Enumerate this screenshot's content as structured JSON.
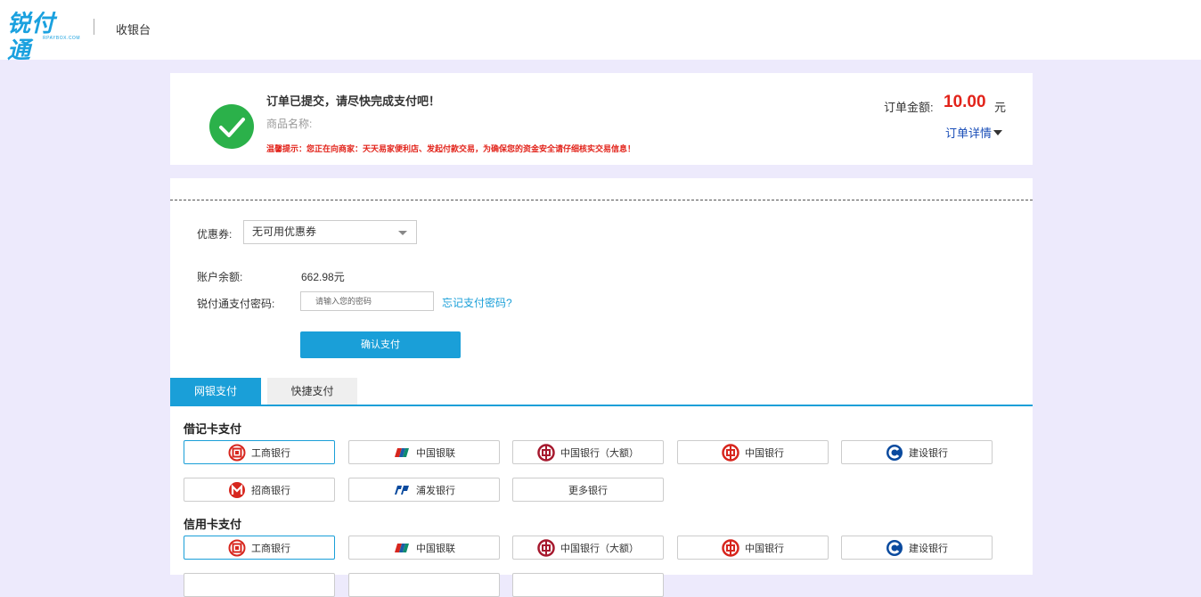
{
  "header": {
    "logo_text": "锐付通",
    "logo_sub": "RPAYBOX.COM",
    "title": "收银台"
  },
  "order": {
    "message": "订单已提交，请尽快完成支付吧！",
    "product_label": "商品名称:",
    "warning": "温馨提示：您正在向商家：天天易家便利店、发起付款交易，为确保您的资金安全请仔细核实交易信息！",
    "amount_label": "订单金额:",
    "amount_value": "10.00",
    "amount_unit": "元",
    "detail_link": "订单详情"
  },
  "payment": {
    "coupon_label": "优惠券:",
    "coupon_selected": "无可用优惠券",
    "balance_label": "账户余额:",
    "balance_value": "662.98元",
    "password_label": "锐付通支付密码:",
    "password_placeholder": "请输入您的密码",
    "forgot_link": "忘记支付密码?",
    "confirm_button": "确认支付"
  },
  "tabs": [
    {
      "label": "网银支付",
      "active": true
    },
    {
      "label": "快捷支付",
      "active": false
    }
  ],
  "debit": {
    "title": "借记卡支付",
    "banks": [
      {
        "label": "工商银行",
        "icon": "icbc-icon",
        "color": "#d7261e"
      },
      {
        "label": "中国银联",
        "icon": "unionpay-icon",
        "color": "#1a5ea8"
      },
      {
        "label": "中国银行（大额）",
        "icon": "boc-icon",
        "color": "#a6192e"
      },
      {
        "label": "中国银行",
        "icon": "boc-icon",
        "color": "#d7261e"
      },
      {
        "label": "建设银行",
        "icon": "ccb-icon",
        "color": "#0a4a9e"
      },
      {
        "label": "招商银行",
        "icon": "cmb-icon",
        "color": "#d7261e"
      },
      {
        "label": "浦发银行",
        "icon": "spdb-icon",
        "color": "#0a4a9e"
      },
      {
        "label": "更多银行",
        "icon": "",
        "color": ""
      }
    ]
  },
  "credit": {
    "title": "信用卡支付",
    "banks": [
      {
        "label": "工商银行",
        "icon": "icbc-icon",
        "color": "#d7261e"
      },
      {
        "label": "中国银联",
        "icon": "unionpay-icon",
        "color": "#1a5ea8"
      },
      {
        "label": "中国银行（大额）",
        "icon": "boc-icon",
        "color": "#a6192e"
      },
      {
        "label": "中国银行",
        "icon": "boc-icon",
        "color": "#d7261e"
      },
      {
        "label": "建设银行",
        "icon": "ccb-icon",
        "color": "#0a4a9e"
      }
    ]
  },
  "colors": {
    "accent": "#1a9fd8",
    "success": "#2bb14a",
    "danger": "#e2231a",
    "page_bg": "#edeafc"
  }
}
